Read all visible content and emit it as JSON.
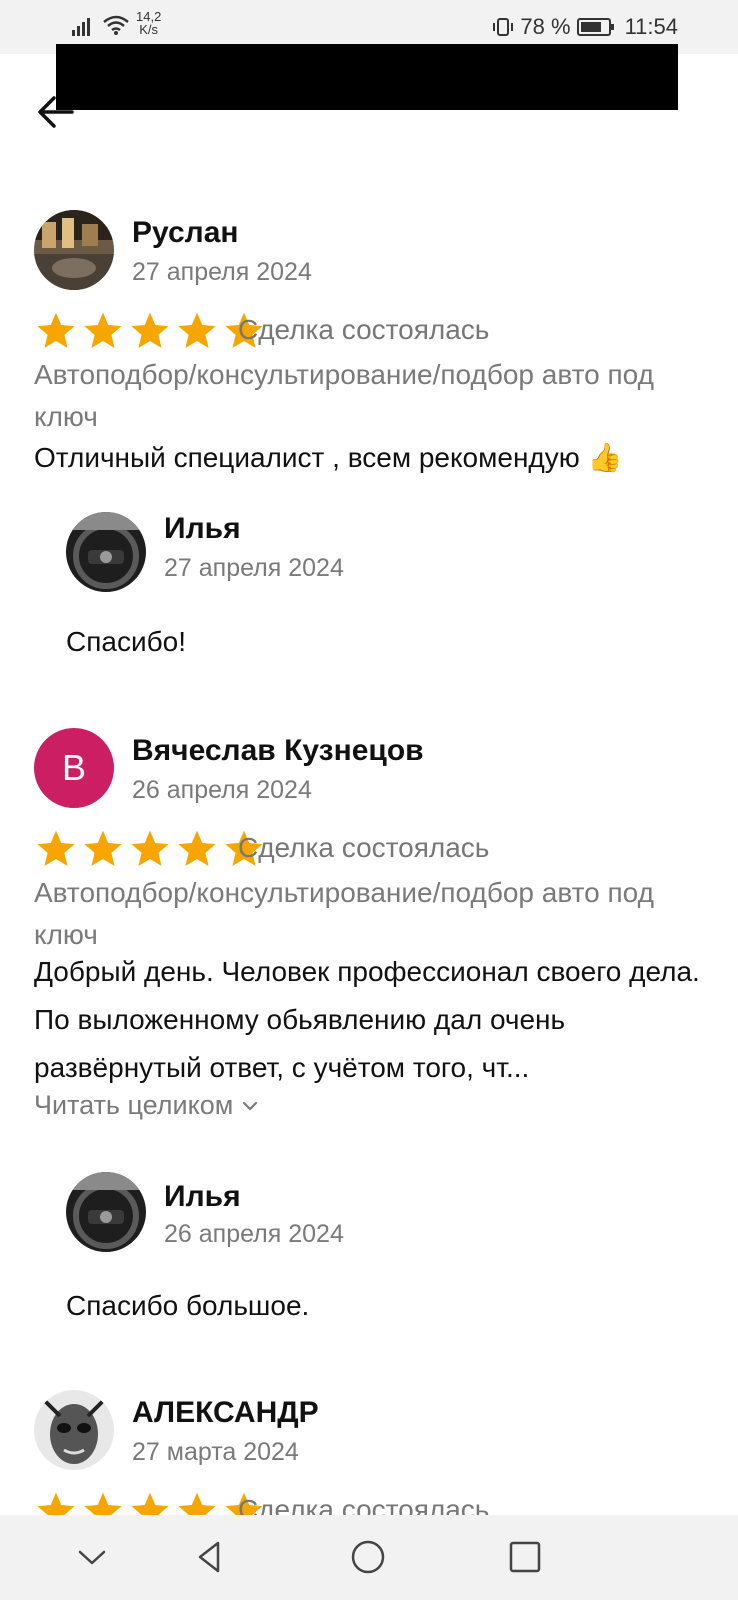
{
  "status_bar": {
    "net_speed_value": "14,2",
    "net_speed_unit": "K/s",
    "battery": "78 %",
    "time": "11:54"
  },
  "reviews": [
    {
      "author": "Руслан",
      "date": "27 апреля 2024",
      "rating": 5,
      "deal_status": "Сделка состоялась",
      "category": "Автоподбор/консультирование/подбор авто под ключ",
      "text": "Отличный специалист ,  всем рекомендую 👍",
      "reply": {
        "author": "Илья",
        "date": "27 апреля 2024",
        "text": "Спасибо!"
      }
    },
    {
      "author": "Вячеслав Кузнецов",
      "avatar_letter": "В",
      "avatar_color": "#cc1f63",
      "date": "26 апреля 2024",
      "rating": 5,
      "deal_status": "Сделка состоялась",
      "category": "Автоподбор/консультирование/подбор авто под ключ",
      "text": "Добрый день. Человек профессионал своего дела. По выложенному обьявлению дал очень развёрнутый ответ, с учётом того, чт...",
      "read_more": "Читать целиком",
      "reply": {
        "author": "Илья",
        "date": "26 апреля 2024",
        "text": "Спасибо большое."
      }
    },
    {
      "author": "АЛЕКСАНДР",
      "date": "27 марта 2024",
      "rating": 5,
      "deal_status": "Сделка состоялась"
    }
  ],
  "colors": {
    "star": "#f7a600",
    "muted_text": "#7a7a7a"
  }
}
